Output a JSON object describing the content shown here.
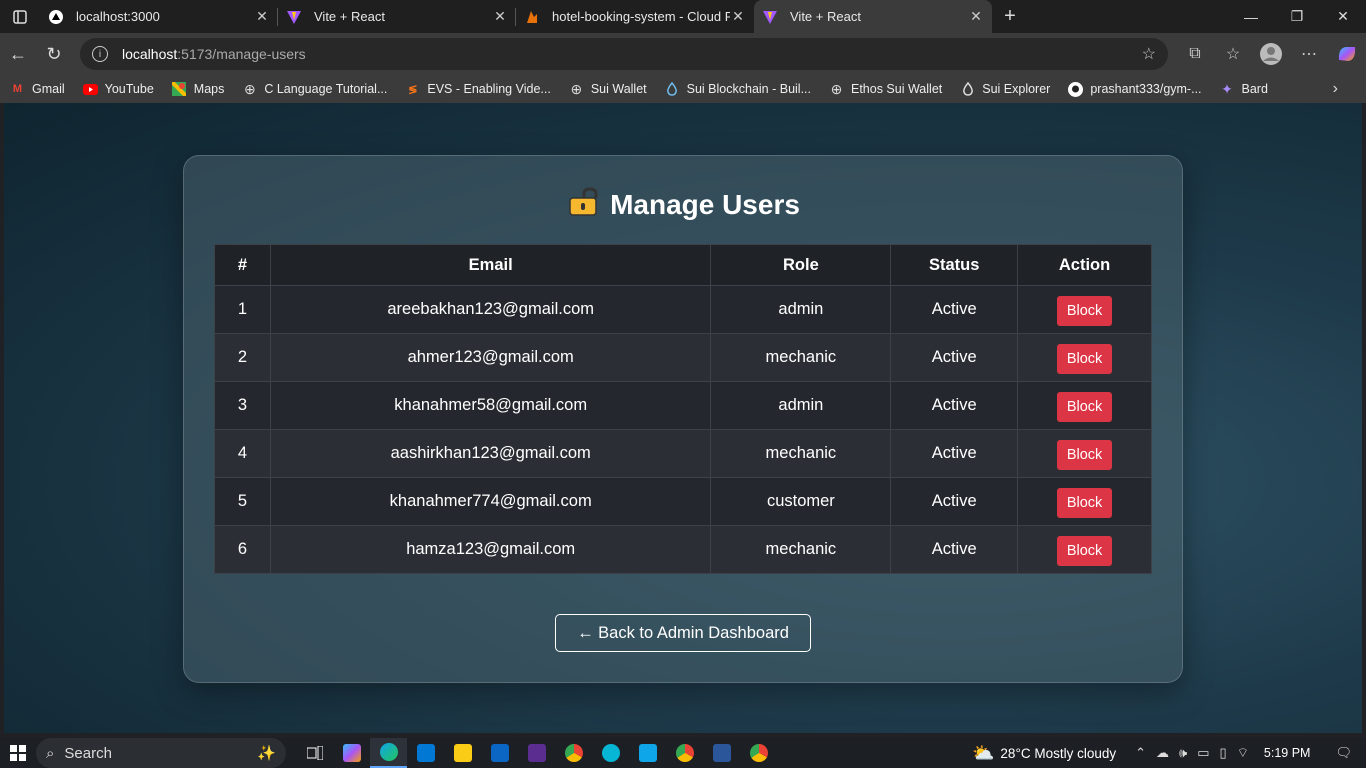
{
  "browser": {
    "tabs": [
      {
        "title": "localhost:3000",
        "active": false
      },
      {
        "title": "Vite + React",
        "active": false
      },
      {
        "title": "hotel-booking-system - Cloud Fir",
        "active": false
      },
      {
        "title": "Vite + React",
        "active": true
      }
    ],
    "address": {
      "host": "localhost",
      "path": ":5173/manage-users"
    },
    "bookmarks": [
      {
        "label": "Gmail",
        "icon": "gmail-icon"
      },
      {
        "label": "YouTube",
        "icon": "youtube-icon"
      },
      {
        "label": "Maps",
        "icon": "maps-icon"
      },
      {
        "label": "C Language Tutorial...",
        "icon": "globe-icon"
      },
      {
        "label": "EVS - Enabling Vide...",
        "icon": "evs-icon"
      },
      {
        "label": "Sui Wallet",
        "icon": "globe-icon"
      },
      {
        "label": "Sui Blockchain - Buil...",
        "icon": "sui-drop-icon"
      },
      {
        "label": "Ethos Sui Wallet",
        "icon": "globe-icon"
      },
      {
        "label": "Sui Explorer",
        "icon": "sui-drop-icon"
      },
      {
        "label": "prashant333/gym-...",
        "icon": "github-icon"
      },
      {
        "label": "Bard",
        "icon": "bard-icon"
      }
    ]
  },
  "page": {
    "title": "Manage Users",
    "table": {
      "headers": [
        "#",
        "Email",
        "Role",
        "Status",
        "Action"
      ],
      "rows": [
        {
          "num": "1",
          "email": "areebakhan123@gmail.com",
          "role": "admin",
          "status": "Active",
          "action": "Block"
        },
        {
          "num": "2",
          "email": "ahmer123@gmail.com",
          "role": "mechanic",
          "status": "Active",
          "action": "Block"
        },
        {
          "num": "3",
          "email": "khanahmer58@gmail.com",
          "role": "admin",
          "status": "Active",
          "action": "Block"
        },
        {
          "num": "4",
          "email": "aashirkhan123@gmail.com",
          "role": "mechanic",
          "status": "Active",
          "action": "Block"
        },
        {
          "num": "5",
          "email": "khanahmer774@gmail.com",
          "role": "customer",
          "status": "Active",
          "action": "Block"
        },
        {
          "num": "6",
          "email": "hamza123@gmail.com",
          "role": "mechanic",
          "status": "Active",
          "action": "Block"
        }
      ]
    },
    "back_button": "← Back to Admin Dashboard"
  },
  "taskbar": {
    "search_placeholder": "Search",
    "weather": "28°C  Mostly cloudy",
    "time": "5:19 PM"
  },
  "colors": {
    "block_button": "#dc3545",
    "tab_active": "#3b3b3b"
  }
}
